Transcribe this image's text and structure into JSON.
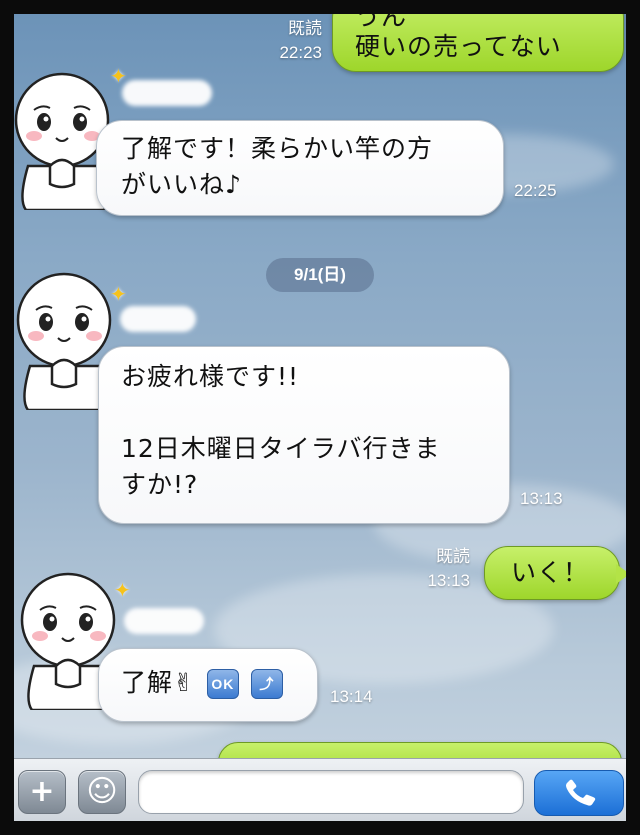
{
  "messages": [
    {
      "id": "m1",
      "side": "out",
      "lines": [
        "うん",
        "硬いの売ってない"
      ],
      "read": "既読",
      "time": "22:23"
    },
    {
      "id": "m2",
      "side": "in",
      "lines": [
        "了解です！柔らかい竿の方",
        "がいいね♪"
      ],
      "time": "22:25"
    },
    {
      "id": "m3",
      "side": "in",
      "lines": [
        "お疲れ様です!!",
        "",
        "12日木曜日タイラバ行きま",
        "すか!?"
      ],
      "time": "13:13"
    },
    {
      "id": "m4",
      "side": "out",
      "lines": [
        "いく！"
      ],
      "read": "既読",
      "time": "13:13"
    },
    {
      "id": "m5",
      "side": "in",
      "text": "了解✌",
      "stamps": [
        "OK",
        "⤴"
      ],
      "time": "13:14"
    }
  ],
  "date_separator": "9/1(日)",
  "input": {
    "plus_label": "+",
    "emoji_label": "☺",
    "placeholder": ""
  },
  "icons": {
    "plus": "plus-icon",
    "emoji": "emoji-icon",
    "call": "phone-icon"
  },
  "colors": {
    "outgoing": "#a8dd37",
    "incoming": "#ffffff",
    "call": "#1c6fd6"
  }
}
